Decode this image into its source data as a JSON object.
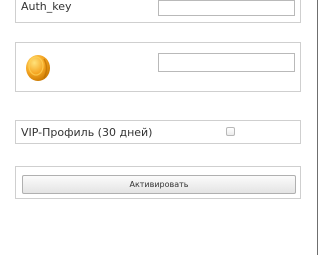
{
  "auth": {
    "label": "Auth_key",
    "value": ""
  },
  "coins": {
    "icon": "gold-coin-icon",
    "value": ""
  },
  "vip": {
    "label": "VIP-Профиль (30 дней)",
    "checked": false
  },
  "activate": {
    "label": "Активировать"
  }
}
